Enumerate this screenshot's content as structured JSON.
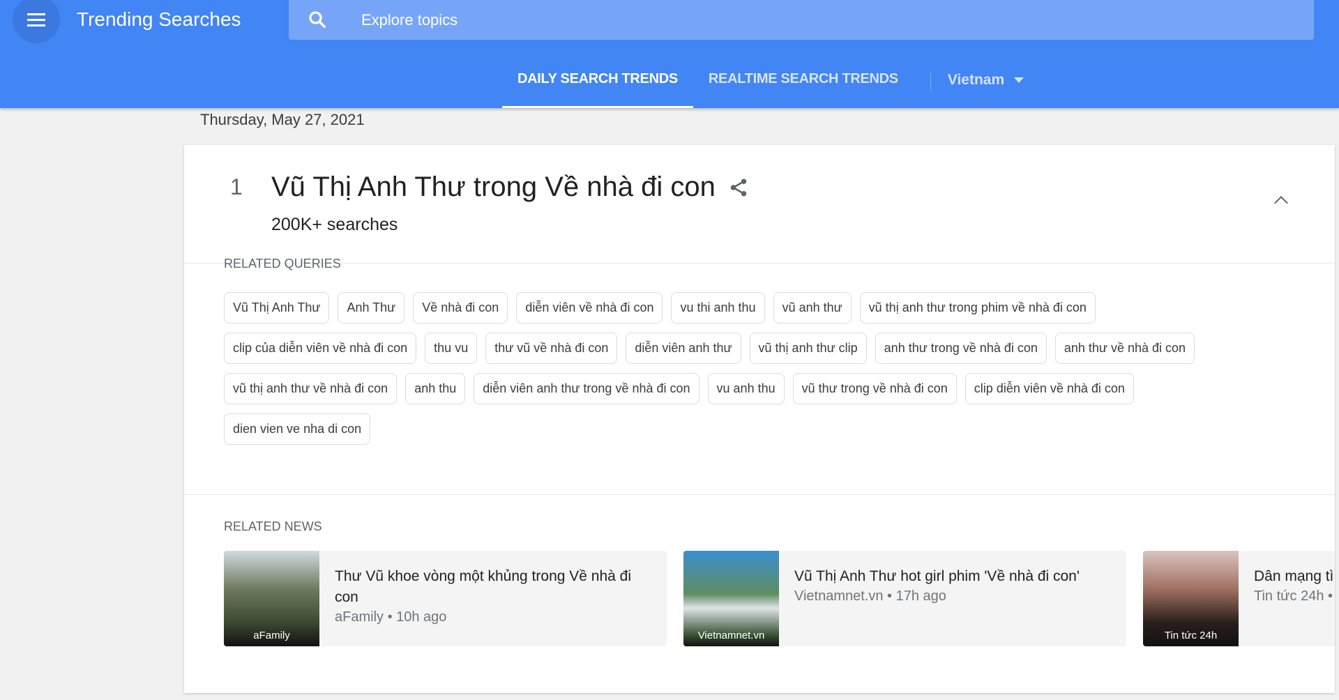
{
  "header": {
    "title": "Trending Searches",
    "search_placeholder": "Explore topics",
    "tabs": [
      "DAILY SEARCH TRENDS",
      "REALTIME SEARCH TRENDS"
    ],
    "country": "Vietnam",
    "accent": "#4285f4"
  },
  "date": "Thursday, May 27, 2021",
  "trend": {
    "rank": "1",
    "title": "Vũ Thị Anh Thư trong Về nhà đi con",
    "searches": "200K+ searches"
  },
  "related_queries": {
    "label": "RELATED QUERIES",
    "rows": [
      [
        "Vũ Thị Anh Thư",
        "Anh Thư",
        "Về nhà đi con",
        "diễn viên về nhà đi con",
        "vu thi anh thu",
        "vũ anh thư",
        "vũ thị anh thư trong phim về nhà đi con"
      ],
      [
        "clip của diễn viên về nhà đi con",
        "thu vu",
        "thư vũ về nhà đi con",
        "diễn viên anh thư",
        "vũ thị anh thư clip",
        "anh thư trong về nhà đi con",
        "anh thư về nhà đi con"
      ],
      [
        "vũ thị anh thư về nhà đi con",
        "anh thu",
        "diễn viên anh thư trong về nhà đi con",
        "vu anh thu",
        "vũ thư trong về nhà đi con",
        "clip diễn viên về nhà đi con"
      ],
      [
        "dien vien ve nha di con"
      ]
    ]
  },
  "related_news": {
    "label": "RELATED NEWS",
    "items": [
      {
        "headline": "Thư Vũ khoe vòng một khủng trong Về nhà đi con",
        "source": "aFamily • 10h ago",
        "thumb_label": "aFamily"
      },
      {
        "headline": "Vũ Thị Anh Thư hot girl phim 'Về nhà đi con'",
        "source": "Vietnamnet.vn • 17h ago",
        "thumb_label": "Vietnamnet.vn"
      },
      {
        "headline": "Dân mạng tì nhà đi con' l",
        "source": "Tin tức 24h •",
        "thumb_label": "Tin tức 24h"
      }
    ]
  }
}
